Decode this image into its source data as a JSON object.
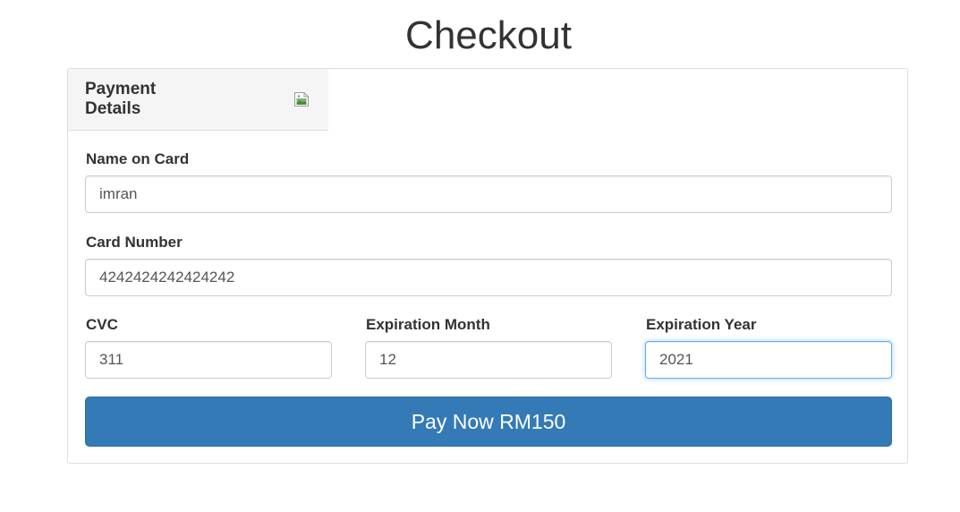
{
  "page": {
    "title": "Checkout"
  },
  "panel": {
    "heading": "Payment Details",
    "card_logo_icon": "broken-image-icon"
  },
  "form": {
    "name_on_card": {
      "label": "Name on Card",
      "value": "imran"
    },
    "card_number": {
      "label": "Card Number",
      "value": "4242424242424242"
    },
    "cvc": {
      "label": "CVC",
      "value": "311"
    },
    "expiration_month": {
      "label": "Expiration Month",
      "value": "12"
    },
    "expiration_year": {
      "label": "Expiration Year",
      "value": "2021"
    },
    "submit_label": "Pay Now RM150"
  },
  "colors": {
    "primary": "#337ab7",
    "focus": "#66afe9",
    "heading_bg": "#f5f5f5",
    "border": "#dddddd"
  }
}
